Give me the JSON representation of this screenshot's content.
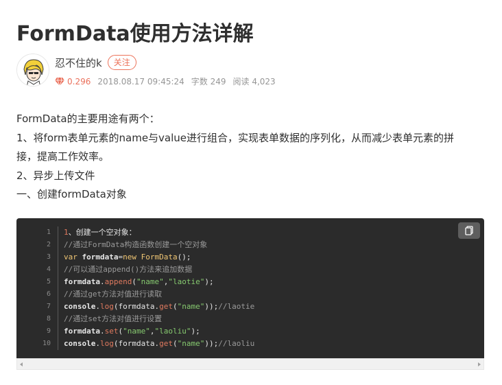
{
  "article": {
    "title": "FormData使用方法详解"
  },
  "author": {
    "name": "忍不住的k",
    "follow_label": "关注",
    "avatar_icon": "cartoon-avatar"
  },
  "meta": {
    "score_icon": "diamond-icon",
    "score": "0.296",
    "date": "2018.08.17 09:45:24",
    "word_count": "字数 249",
    "read_count": "阅读 4,023"
  },
  "body": {
    "paragraphs": [
      "FormData的主要用途有两个：",
      "1、将form表单元素的name与value进行组合，实现表单数据的序列化，从而减少表单元素的拼",
      "接，提高工作效率。",
      "2、异步上传文件",
      "一、创建formData对象"
    ]
  },
  "code": {
    "line_numbers": [
      "1",
      "2",
      "3",
      "4",
      "5",
      "6",
      "7",
      "8",
      "9",
      "10"
    ],
    "lines": [
      [
        {
          "t": "1",
          "c": "num"
        },
        {
          "t": "、创建一个空对象：",
          "c": "plain"
        }
      ],
      [
        {
          "t": "//通过FormData构造函数创建一个空对象",
          "c": "comment"
        }
      ],
      [
        {
          "t": "var ",
          "c": "kw"
        },
        {
          "t": "formdata",
          "c": "id"
        },
        {
          "t": "=",
          "c": "plain"
        },
        {
          "t": "new ",
          "c": "kw"
        },
        {
          "t": "FormData",
          "c": "cls"
        },
        {
          "t": "();",
          "c": "plain"
        }
      ],
      [
        {
          "t": "//可以通过append()方法来追加数据",
          "c": "comment"
        }
      ],
      [
        {
          "t": "formdata",
          "c": "id"
        },
        {
          "t": ".",
          "c": "plain"
        },
        {
          "t": "append",
          "c": "fn"
        },
        {
          "t": "(",
          "c": "plain"
        },
        {
          "t": "\"name\"",
          "c": "str"
        },
        {
          "t": ",",
          "c": "plain"
        },
        {
          "t": "\"laotie\"",
          "c": "str"
        },
        {
          "t": ");",
          "c": "plain"
        }
      ],
      [
        {
          "t": "//通过get方法对值进行读取",
          "c": "comment"
        }
      ],
      [
        {
          "t": "console",
          "c": "id"
        },
        {
          "t": ".",
          "c": "plain"
        },
        {
          "t": "log",
          "c": "fn"
        },
        {
          "t": "(formdata.",
          "c": "plain"
        },
        {
          "t": "get",
          "c": "fn"
        },
        {
          "t": "(",
          "c": "plain"
        },
        {
          "t": "\"name\"",
          "c": "str"
        },
        {
          "t": "));",
          "c": "plain"
        },
        {
          "t": "//laotie",
          "c": "comment"
        }
      ],
      [
        {
          "t": "//通过set方法对值进行设置",
          "c": "comment"
        }
      ],
      [
        {
          "t": "formdata",
          "c": "id"
        },
        {
          "t": ".",
          "c": "plain"
        },
        {
          "t": "set",
          "c": "fn"
        },
        {
          "t": "(",
          "c": "plain"
        },
        {
          "t": "\"name\"",
          "c": "str"
        },
        {
          "t": ",",
          "c": "plain"
        },
        {
          "t": "\"laoliu\"",
          "c": "str"
        },
        {
          "t": ");",
          "c": "plain"
        }
      ],
      [
        {
          "t": "console",
          "c": "id"
        },
        {
          "t": ".",
          "c": "plain"
        },
        {
          "t": "log",
          "c": "fn"
        },
        {
          "t": "(formdata.",
          "c": "plain"
        },
        {
          "t": "get",
          "c": "fn"
        },
        {
          "t": "(",
          "c": "plain"
        },
        {
          "t": "\"name\"",
          "c": "str"
        },
        {
          "t": "));",
          "c": "plain"
        },
        {
          "t": "//laoliu",
          "c": "comment"
        }
      ]
    ],
    "copy_icon": "copy-icon"
  },
  "colors": {
    "accent": "#ec7259",
    "code_bg": "#2b2b2b"
  }
}
